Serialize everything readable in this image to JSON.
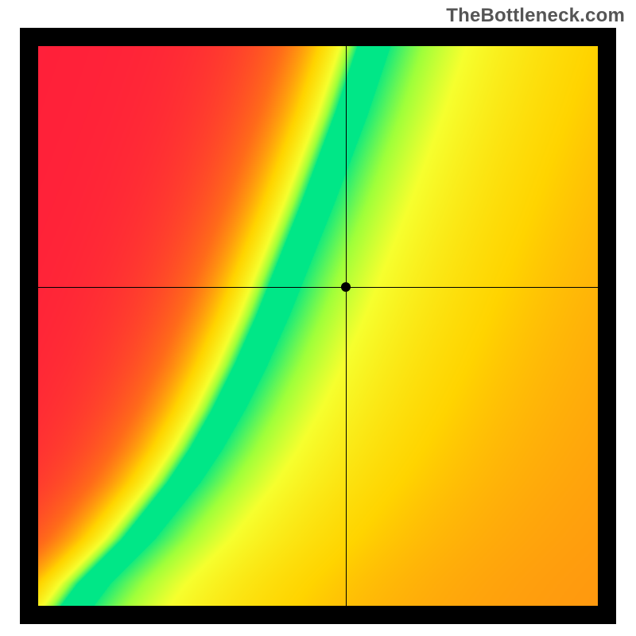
{
  "watermark": "TheBottleneck.com",
  "chart_data": {
    "type": "heatmap",
    "title": "",
    "xlabel": "",
    "ylabel": "",
    "xlim": [
      0,
      100
    ],
    "ylim": [
      0,
      100
    ],
    "grid": false,
    "legend": "none",
    "color_scale": {
      "0.0": "#ff1f3a",
      "0.25": "#ff6a1a",
      "0.5": "#ffd400",
      "0.72": "#f6ff2e",
      "0.85": "#9fff3a",
      "1.0": "#00e787"
    },
    "ridge_curve_description": "Optimal-match ridge (value≈1.0) running from bottom-left (≈7,0) with a shallow start, curving upward through mid-plot, steepening to near-vertical toward top edge at x≈60.",
    "ridge_points_xy": [
      [
        7,
        0
      ],
      [
        10,
        4
      ],
      [
        14,
        8
      ],
      [
        18,
        12
      ],
      [
        22,
        17
      ],
      [
        26,
        22
      ],
      [
        30,
        28
      ],
      [
        34,
        35
      ],
      [
        38,
        43
      ],
      [
        42,
        52
      ],
      [
        46,
        62
      ],
      [
        50,
        72
      ],
      [
        53,
        80
      ],
      [
        56,
        88
      ],
      [
        58,
        94
      ],
      [
        60,
        100
      ]
    ],
    "ridge_width_fraction_of_x_axis": 0.06,
    "crosshair": {
      "x": 55.0,
      "y": 57.0
    },
    "marker": {
      "x": 55.0,
      "y": 57.0,
      "label": ""
    },
    "annotations": []
  }
}
